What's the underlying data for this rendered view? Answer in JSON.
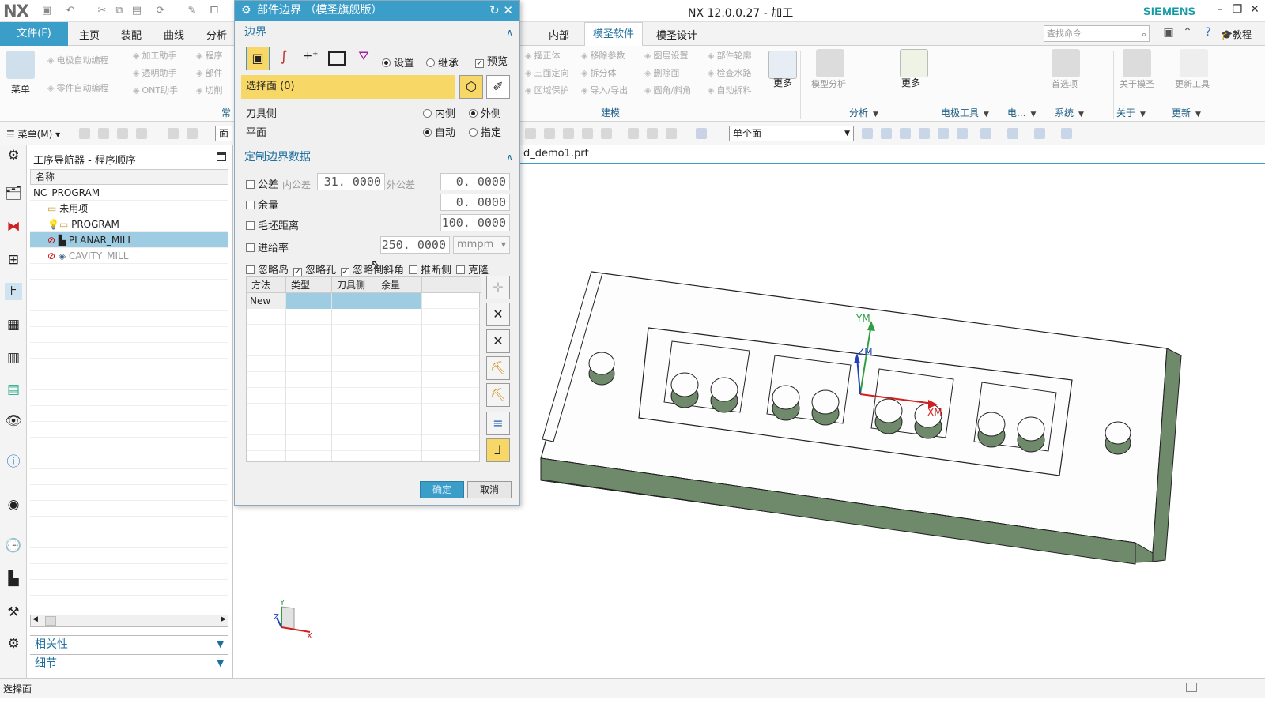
{
  "titlebar": {
    "logo": "NX",
    "title": "NX 12.0.0.27 - 加工",
    "brand": "SIEMENS"
  },
  "menubar": {
    "file": "文件(F)",
    "tabs": [
      "主页",
      "装配",
      "曲线",
      "分析"
    ],
    "right_tabs": [
      "内部",
      "模圣软件",
      "模圣设计"
    ],
    "active_tab": "模圣软件",
    "search_placeholder": "查找命令",
    "tutorial": "教程"
  },
  "ribbon": {
    "menu_label": "菜单",
    "left_buttons": [
      "电极自动编程",
      "加工助手",
      "程序",
      "透明助手",
      "部件",
      "零件自动编程",
      "ONT助手",
      "切削"
    ],
    "center_buttons": [
      "摆正体",
      "移除参数",
      "图层设置",
      "部件轮廓",
      "三面定向",
      "拆分体",
      "删除面",
      "检查水路",
      "区域保护",
      "导入/导出",
      "圆角/斜角",
      "自动拆料"
    ],
    "more1": "更多",
    "model_analysis": "模型分析",
    "more2": "更多",
    "prefs": "首选项",
    "about": "关于模圣",
    "update_tool": "更新工具",
    "groups": [
      "常",
      "建模",
      "分析",
      "电极工具",
      "电...",
      "系统",
      "关于",
      "更新"
    ]
  },
  "toolbar2": {
    "menu": "菜单(M)",
    "combo": "面",
    "select_filter": "单个面"
  },
  "navigator": {
    "title": "工序导航器 - 程序顺序",
    "column": "名称",
    "rows": [
      {
        "label": "NC_PROGRAM",
        "indent": 0,
        "state": "normal"
      },
      {
        "label": "未用项",
        "indent": 1,
        "state": "normal"
      },
      {
        "label": "PROGRAM",
        "indent": 1,
        "state": "normal"
      },
      {
        "label": "PLANAR_MILL",
        "indent": 1,
        "state": "selected"
      },
      {
        "label": "CAVITY_MILL",
        "indent": 1,
        "state": "grey"
      }
    ],
    "panel1": "相关性",
    "panel2": "细节"
  },
  "graphics": {
    "file_tab": "d_demo1.prt",
    "axis_ym": "YM",
    "axis_zm": "ZM",
    "axis_xm": "XM",
    "triad_y": "Y",
    "triad_z": "Z",
    "triad_x": "X"
  },
  "dialog": {
    "title": "部件边界 （模圣旗舰版）",
    "section_boundary": "边界",
    "mode_set": "设置",
    "mode_inherit": "继承",
    "preview": "预览",
    "select_face": "选择面 (0)",
    "tool_side_label": "刀具侧",
    "tool_side_in": "内侧",
    "tool_side_out": "外侧",
    "plane_label": "平面",
    "plane_auto": "自动",
    "plane_specify": "指定",
    "section_custom": "定制边界数据",
    "tolerance": "公差",
    "inner_tol_label": "内公差",
    "inner_tol": "31. 0000",
    "outer_tol_label": "外公差",
    "outer_tol": "0. 0000",
    "stock": "余量",
    "stock_val": "0. 0000",
    "blank_dist": "毛坯距离",
    "blank_val": "100. 0000",
    "feed": "进给率",
    "feed_val": "250. 0000",
    "feed_unit": "mmpm",
    "ignore_island": "忽略岛",
    "ignore_hole": "忽略孔",
    "ignore_chamfer": "忽略倒斜角",
    "extrapolate": "推断侧",
    "clone": "克隆",
    "table_headers": [
      "方法",
      "类型",
      "刀具侧",
      "余量"
    ],
    "table_rows": [
      [
        "New",
        "",
        "",
        ""
      ]
    ],
    "ok": "确定",
    "cancel": "取消"
  },
  "status": "选择面",
  "colors": {
    "accent": "#3b9ec9",
    "select_highlight": "#f7d766",
    "nav_selected": "#9dcce3",
    "part_side": "#6f8a6a"
  }
}
